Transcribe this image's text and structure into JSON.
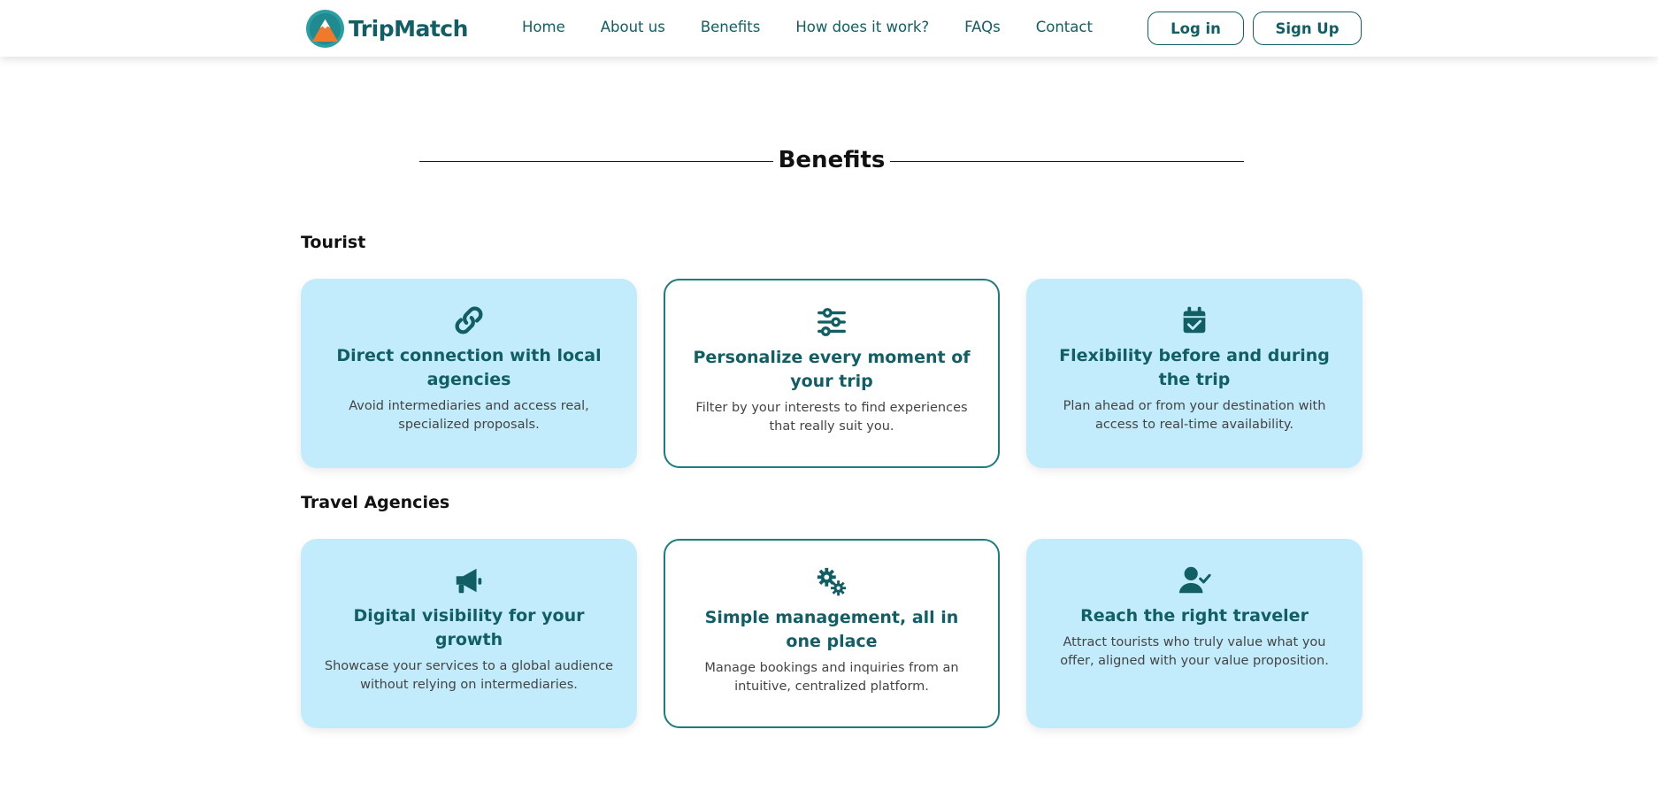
{
  "brand": {
    "name": "TripMatch"
  },
  "nav": [
    {
      "label": "Home"
    },
    {
      "label": "About us"
    },
    {
      "label": "Benefits"
    },
    {
      "label": "How does it work?"
    },
    {
      "label": "FAQs"
    },
    {
      "label": "Contact"
    }
  ],
  "auth": {
    "login_label": "Log in",
    "signup_label": "Sign Up"
  },
  "benefits": {
    "title": "Benefits",
    "groups": [
      {
        "label": "Tourist",
        "cards": [
          {
            "icon": "link-icon",
            "title": "Direct connection with local agencies",
            "text": "Avoid intermediaries and access real, specialized proposals."
          },
          {
            "icon": "sliders-icon",
            "title": "Personalize every moment of your trip",
            "text": "Filter by your interests to find experiences that really suit you."
          },
          {
            "icon": "calendar-check-icon",
            "title": "Flexibility before and during the trip",
            "text": "Plan ahead or from your destination with access to real-time availability."
          }
        ]
      },
      {
        "label": "Travel Agencies",
        "cards": [
          {
            "icon": "megaphone-icon",
            "title": "Digital visibility for your growth",
            "text": "Showcase your services to a global audience without relying on intermediaries."
          },
          {
            "icon": "gears-icon",
            "title": "Simple management, all in one place",
            "text": "Manage bookings and inquiries from an intuitive, centralized platform."
          },
          {
            "icon": "user-check-icon",
            "title": "Reach the right traveler",
            "text": "Attract tourists who truly value what you offer, aligned with your value proposition."
          }
        ]
      }
    ]
  },
  "colors": {
    "brand": "#115e64",
    "card_fill": "#c2ecfb",
    "card_border": "#1a7d80"
  }
}
